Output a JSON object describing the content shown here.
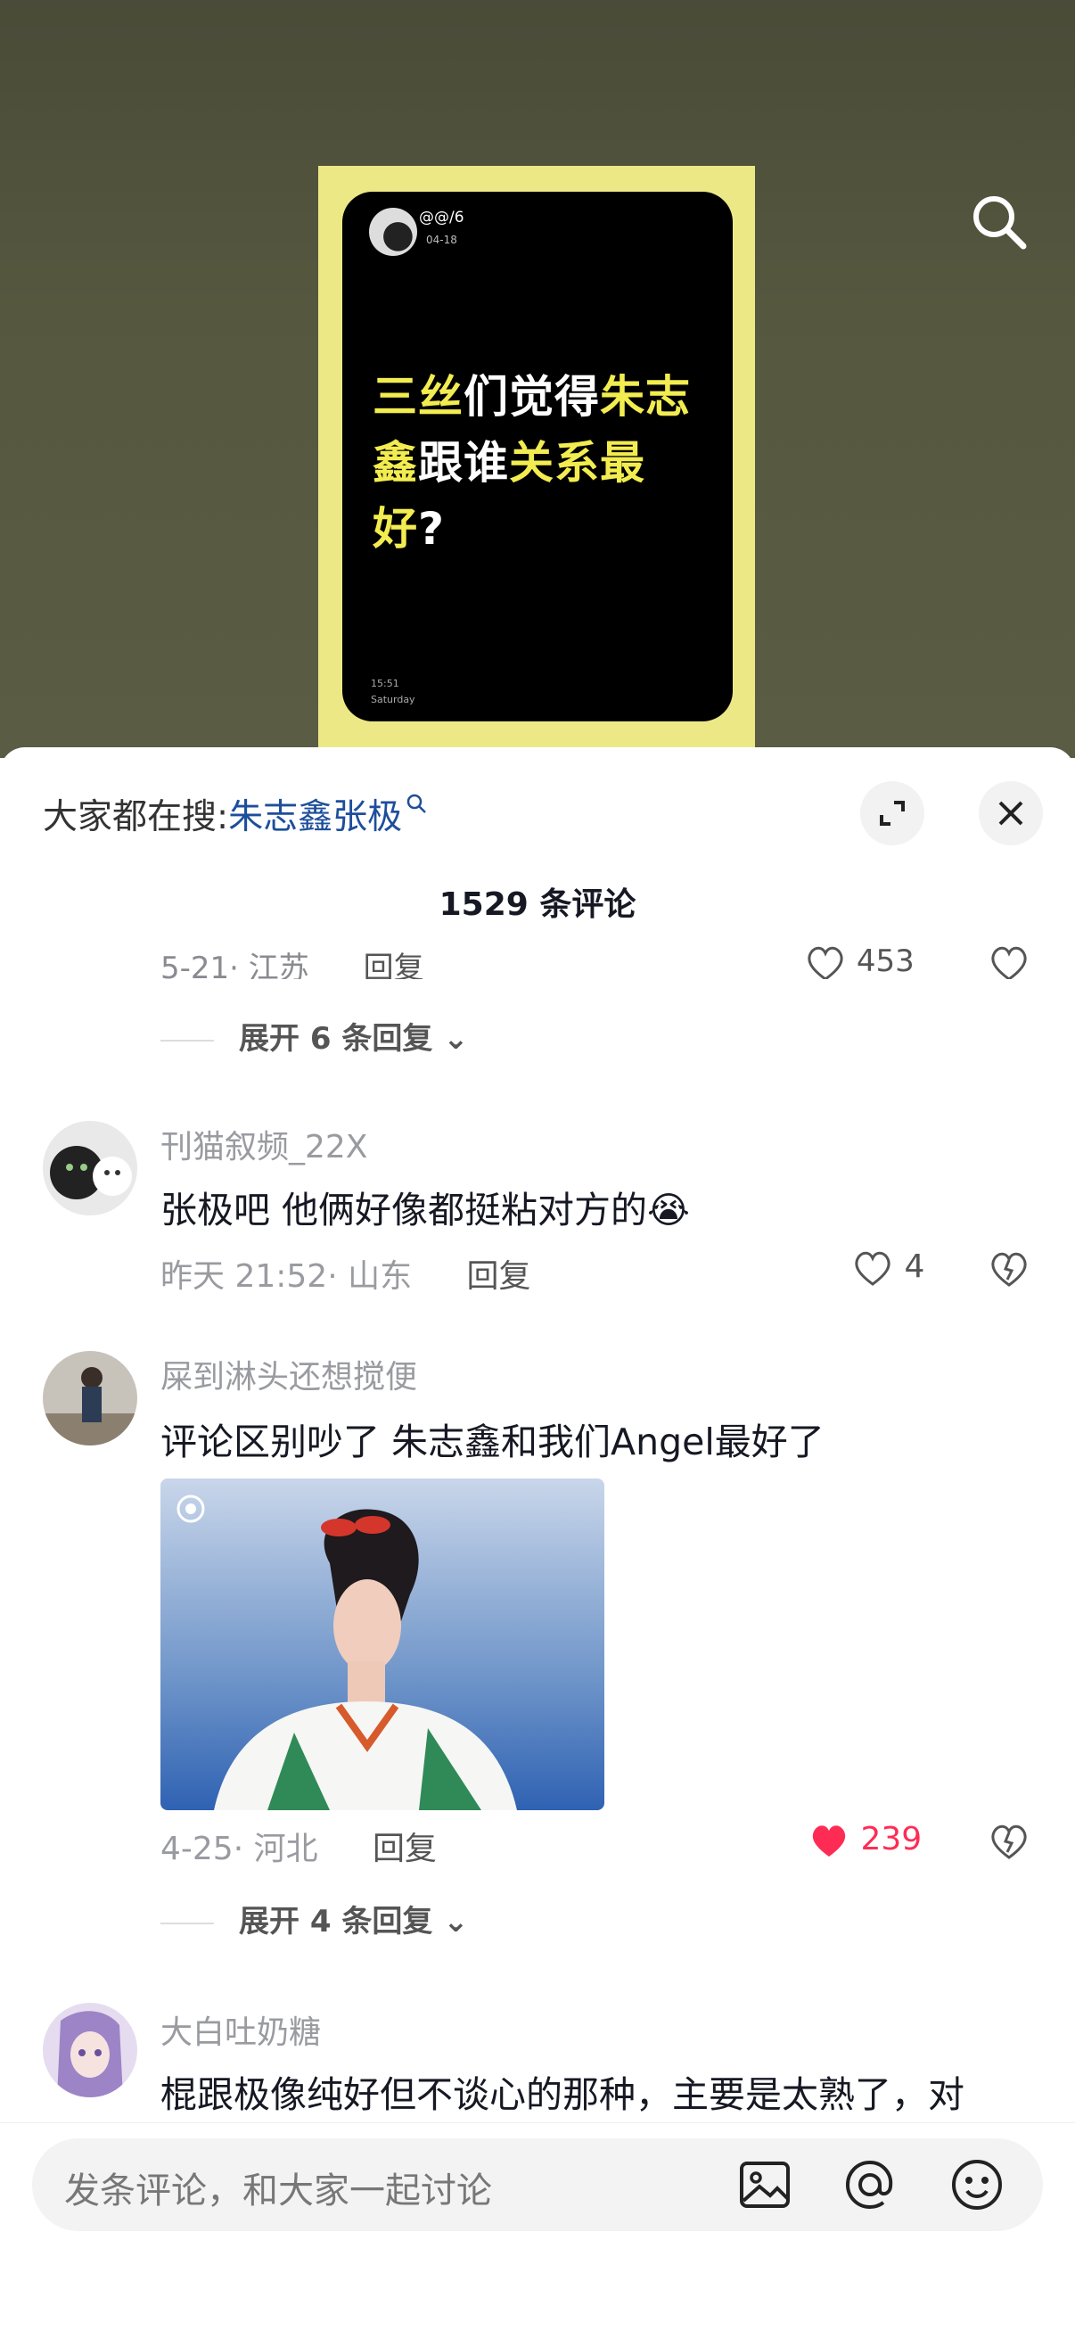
{
  "video": {
    "card_username": "@@/6",
    "card_date": "04-18",
    "headline_parts": [
      {
        "text": "三丝",
        "highlight": true
      },
      {
        "text": "们觉得",
        "highlight": false
      },
      {
        "text": "朱志鑫",
        "highlight": true
      },
      {
        "text": "跟谁",
        "highlight": false
      },
      {
        "text": "关系",
        "highlight": true
      },
      {
        "text": "最好",
        "highlight": true
      },
      {
        "text": "?",
        "highlight": false
      }
    ],
    "card_time": "15:51",
    "card_day": "Saturday"
  },
  "sheet": {
    "trending_prefix": "大家都在搜:",
    "trending_keyword": "朱志鑫张极",
    "comment_count": "1529 条评论",
    "prev_meta": "5-21· 江苏",
    "prev_reply": "回复",
    "prev_likes": "453",
    "prev_expand": "展开 6 条回复"
  },
  "comments": [
    {
      "username": "刊猫叙频_22X",
      "text": "张极吧 他俩好像都挺粘对方的😭",
      "meta": "昨天 21:52· 山东",
      "reply": "回复",
      "likes": "4"
    },
    {
      "username": "屎到淋头还想搅便",
      "text": "评论区别吵了 朱志鑫和我们Angel最好了",
      "meta": "4-25· 河北",
      "reply": "回复",
      "likes": "239",
      "expand": "展开 4 条回复"
    },
    {
      "username": "大白吐奶糖",
      "text": "棍跟极像纯好但不谈心的那种，主要是太熟了，对"
    }
  ],
  "bottom": {
    "placeholder": "发条评论，和大家一起讨论"
  },
  "colors": {
    "accent_like": "#fe2c55",
    "keyword": "#1d4e9b",
    "poster_yellow": "#ece886"
  }
}
